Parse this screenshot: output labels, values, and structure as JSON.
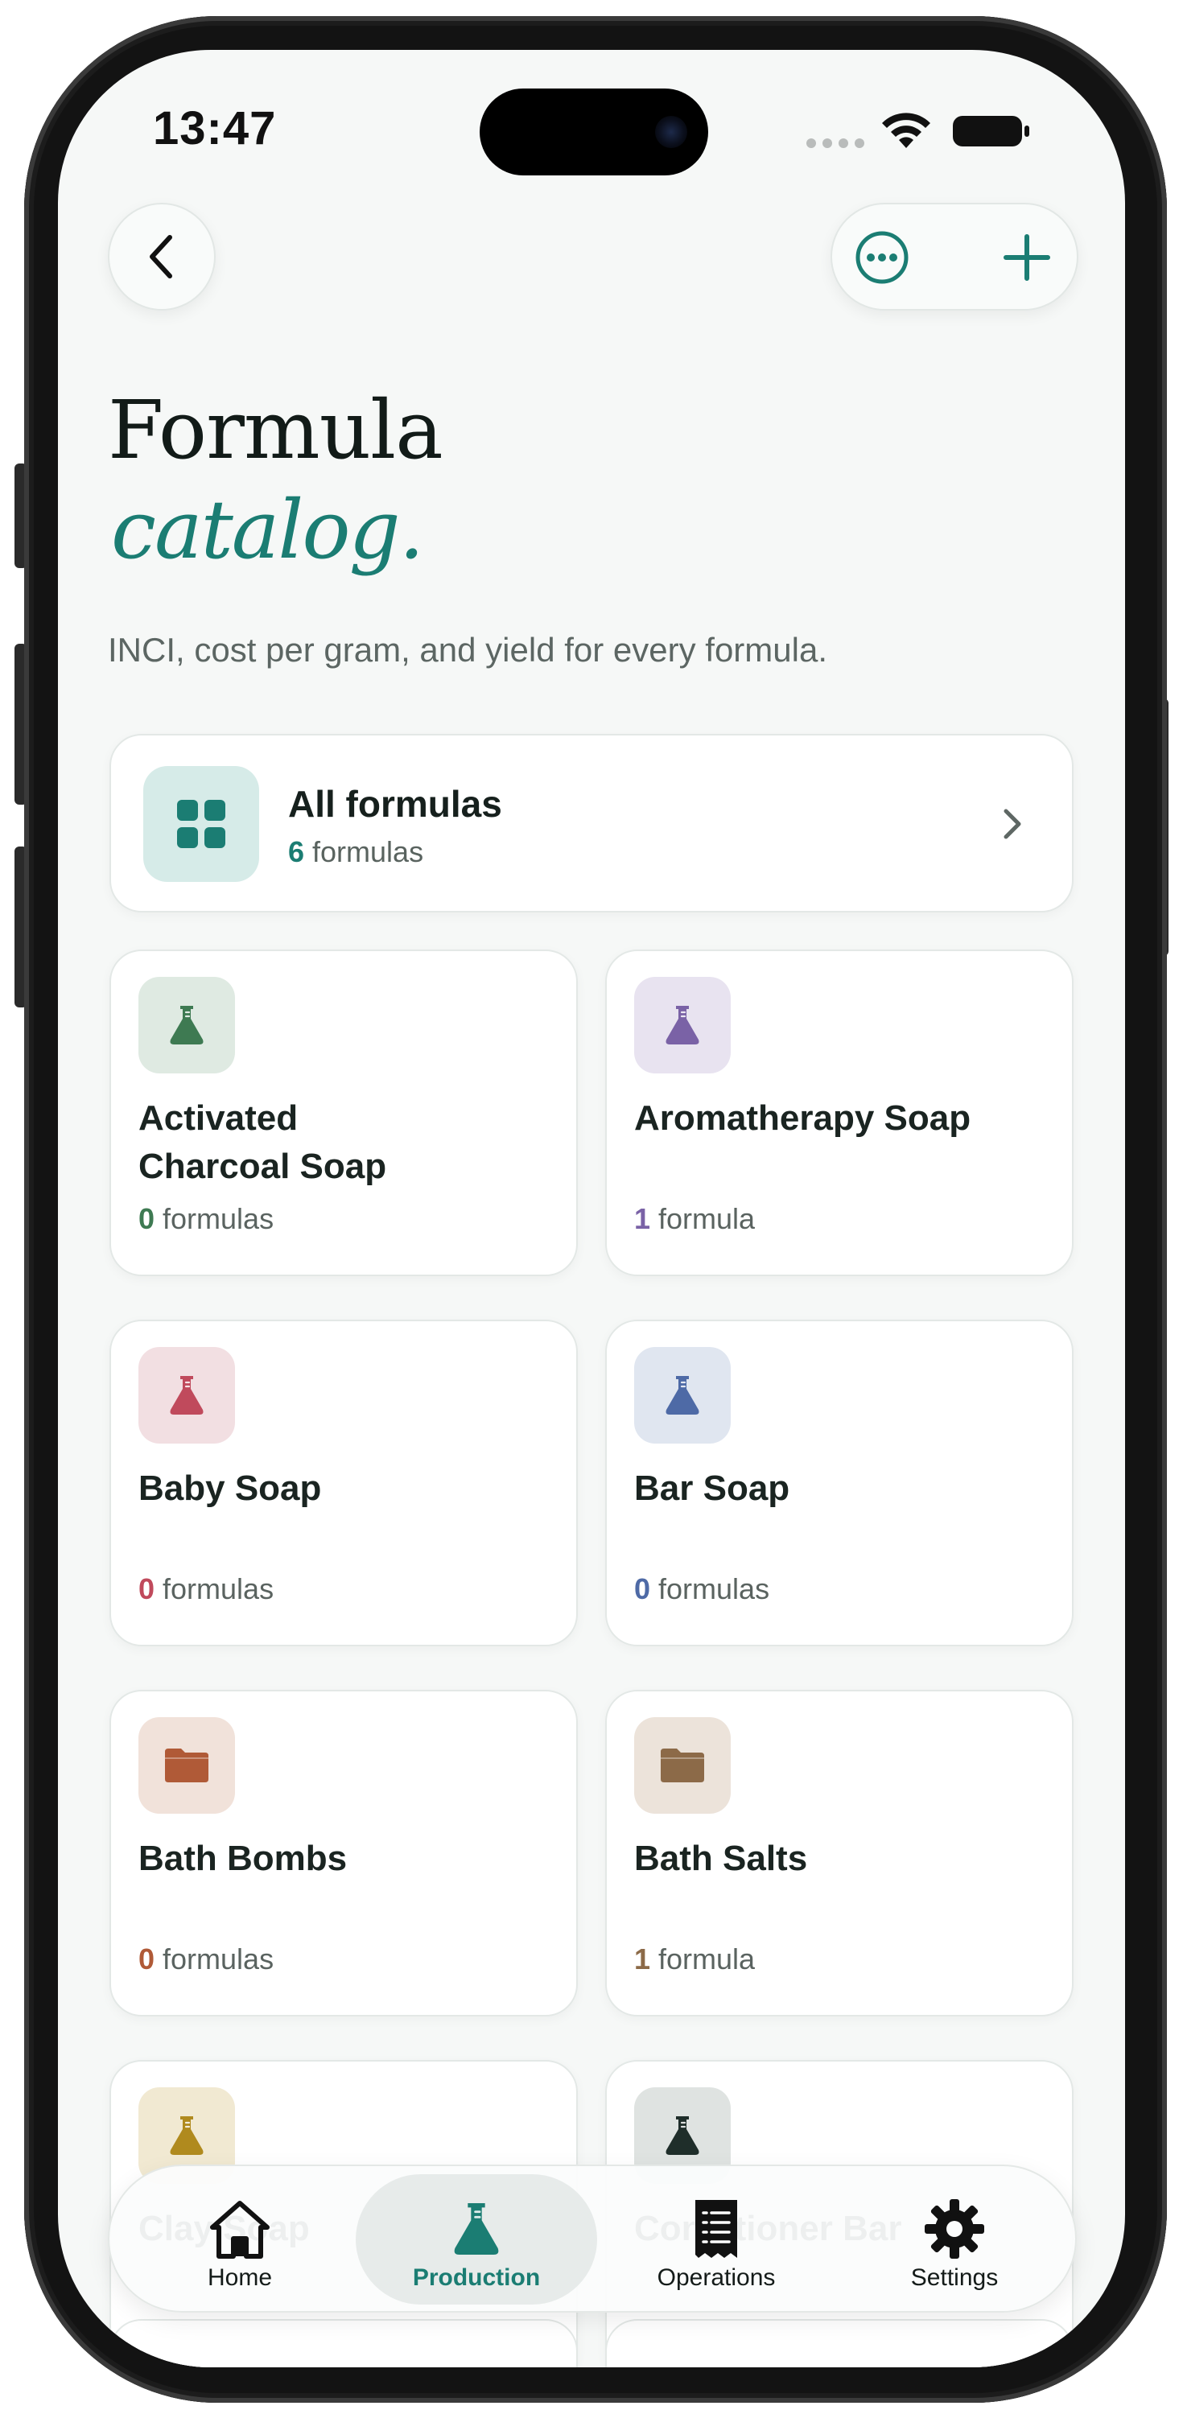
{
  "status_bar": {
    "time": "13:47"
  },
  "header": {
    "title_line1": "Formula",
    "title_line2": "catalog.",
    "subtitle": "INCI, cost per gram, and yield for every formula."
  },
  "all_formulas": {
    "title": "All formulas",
    "count": "6",
    "count_label": "formulas"
  },
  "categories": [
    {
      "name": "Activated\nCharcoal Soap",
      "count": "0",
      "count_label": "formulas",
      "icon": "flask-icon",
      "accent": "#3e7a52",
      "icon_bg": "#dfeae2"
    },
    {
      "name": "Aromatherapy Soap",
      "count": "1",
      "count_label": "formula",
      "icon": "flask-icon",
      "accent": "#7a62a6",
      "icon_bg": "#e8e3f0"
    },
    {
      "name": "Baby Soap",
      "count": "0",
      "count_label": "formulas",
      "icon": "flask-icon",
      "accent": "#c04a5c",
      "icon_bg": "#f2dfe2"
    },
    {
      "name": "Bar Soap",
      "count": "0",
      "count_label": "formulas",
      "icon": "flask-icon",
      "accent": "#4e6aa6",
      "icon_bg": "#e0e6f0"
    },
    {
      "name": "Bath Bombs",
      "count": "0",
      "count_label": "formulas",
      "icon": "folder-icon",
      "accent": "#b05a37",
      "icon_bg": "#f1e2da"
    },
    {
      "name": "Bath Salts",
      "count": "1",
      "count_label": "formula",
      "icon": "folder-icon",
      "accent": "#8c6a48",
      "icon_bg": "#ece3da"
    },
    {
      "name": "Clay Soap",
      "count": "",
      "count_label": "",
      "icon": "flask-icon",
      "accent": "#b08a1e",
      "icon_bg": "#f1e9d2"
    },
    {
      "name": "Conditioner Bar",
      "count": "",
      "count_label": "",
      "icon": "flask-icon",
      "accent": "#1f2e2a",
      "icon_bg": "#dfe3e1"
    }
  ],
  "tab_bar": {
    "tabs": [
      {
        "label": "Home",
        "icon": "home-icon",
        "active": false
      },
      {
        "label": "Production",
        "icon": "flask-icon",
        "active": true
      },
      {
        "label": "Operations",
        "icon": "receipt-icon",
        "active": false
      },
      {
        "label": "Settings",
        "icon": "gear-icon",
        "active": false
      }
    ]
  },
  "colors": {
    "accent": "#1b7d73",
    "background": "#f6f8f7",
    "text": "#16201d"
  }
}
